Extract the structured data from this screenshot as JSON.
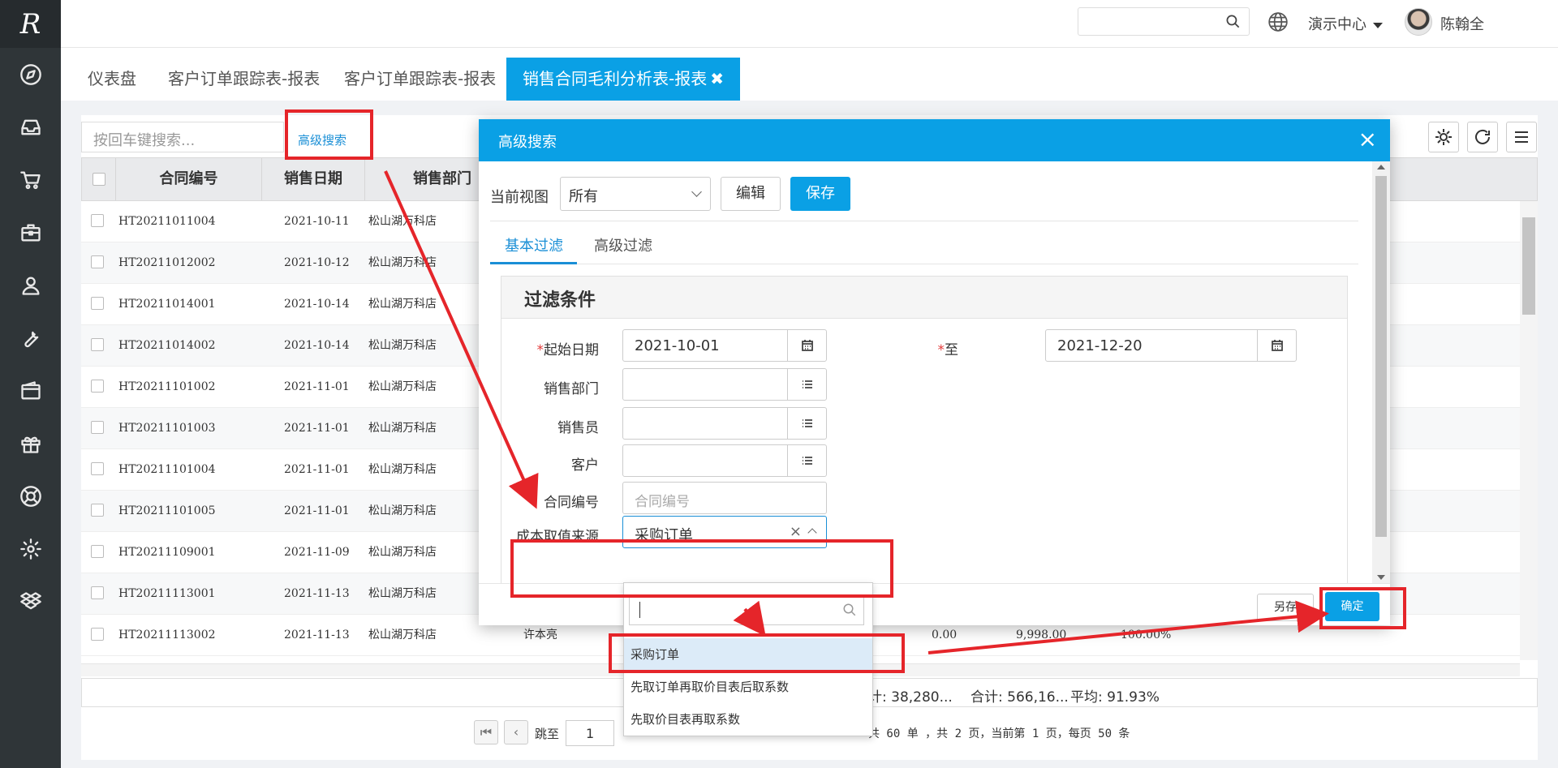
{
  "app": {
    "logo_text": "R"
  },
  "sidebar": {
    "icons": [
      "compass-icon",
      "inbox-icon",
      "cart-icon",
      "briefcase-icon",
      "user-icon",
      "wrench-icon",
      "wallet-icon",
      "gift-icon",
      "lifebuoy-icon",
      "gear-icon",
      "dropbox-icon"
    ]
  },
  "header": {
    "demo_center": "演示中心",
    "user_name": "陈翰全",
    "help": "?"
  },
  "tabs": [
    {
      "label": "仪表盘"
    },
    {
      "label": "客户订单跟踪表-报表"
    },
    {
      "label": "客户订单跟踪表-报表"
    },
    {
      "label": "销售合同毛利分析表-报表",
      "active": true,
      "close": "✖"
    }
  ],
  "panel": {
    "search_placeholder": "按回车键搜索...",
    "advanced_search_link": "高级搜索"
  },
  "table": {
    "columns": [
      "合同编号",
      "销售日期",
      "销售部门"
    ],
    "rows": [
      {
        "no": "HT20211011004",
        "date": "2021-10-11",
        "dept": "松山湖万科店"
      },
      {
        "no": "HT20211012002",
        "date": "2021-10-12",
        "dept": "松山湖万科店"
      },
      {
        "no": "HT20211014001",
        "date": "2021-10-14",
        "dept": "松山湖万科店"
      },
      {
        "no": "HT20211014002",
        "date": "2021-10-14",
        "dept": "松山湖万科店"
      },
      {
        "no": "HT20211101002",
        "date": "2021-11-01",
        "dept": "松山湖万科店"
      },
      {
        "no": "HT20211101003",
        "date": "2021-11-01",
        "dept": "松山湖万科店"
      },
      {
        "no": "HT20211101004",
        "date": "2021-11-01",
        "dept": "松山湖万科店"
      },
      {
        "no": "HT20211101005",
        "date": "2021-11-01",
        "dept": "松山湖万科店"
      },
      {
        "no": "HT20211109001",
        "date": "2021-11-09",
        "dept": "松山湖万科店"
      },
      {
        "no": "HT20211113001",
        "date": "2021-11-13",
        "dept": "松山湖万科店"
      },
      {
        "no": "HT20211113002",
        "date": "2021-11-13",
        "dept": "松山湖万科店",
        "salesman": "许本亮",
        "cost": "0.00",
        "profit": "9,998.00",
        "rate": "100.00%"
      }
    ],
    "summary": {
      "sum1": "计: 38,280...",
      "sum2": "合计: 566,16...",
      "avg": "平均: 91.93%"
    }
  },
  "pager": {
    "goto_label": "跳至",
    "page_value": "1",
    "info": "共 60 单 ，共 2 页，当前第 1 页，每页 50 条"
  },
  "modal": {
    "title": "高级搜索",
    "close": "×",
    "view_label": "当前视图",
    "view_value": "所有",
    "edit_button": "编辑",
    "save_button": "保存",
    "filter_tabs": [
      "基本过滤",
      "高级过滤"
    ],
    "filter_title": "过滤条件",
    "fields": {
      "start_date_label": "起始日期",
      "start_date_value": "2021-10-01",
      "end_date_label": "至",
      "end_date_value": "2021-12-20",
      "dept_label": "销售部门",
      "salesman_label": "销售员",
      "customer_label": "客户",
      "contract_label": "合同编号",
      "contract_placeholder": "合同编号",
      "cost_source_label": "成本取值来源",
      "cost_source_value": "采购订单",
      "clear": "×",
      "required_mark": "*"
    },
    "saveas_button": "另存",
    "ok_button": "确定"
  },
  "dropdown": {
    "options": [
      "采购订单",
      "先取订单再取价目表后取系数",
      "先取价目表再取系数"
    ],
    "selected": "采购订单"
  },
  "colors": {
    "primary": "#0aa0e5",
    "sidebar": "#2f3538",
    "annotation": "#e5252a"
  }
}
